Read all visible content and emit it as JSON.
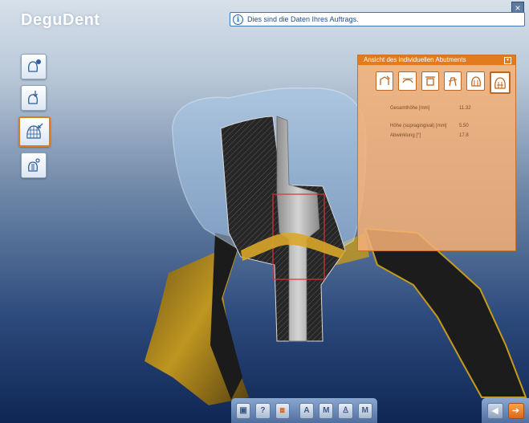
{
  "app": {
    "title": "DeguDent"
  },
  "window": {
    "close_glyph": "×"
  },
  "info": {
    "icon_glyph": "i",
    "message": "Dies sind die Daten Ihres Auftrags."
  },
  "left_toolbar": {
    "items": [
      {
        "icon": "crown-info-icon"
      },
      {
        "icon": "crown-arrow-icon"
      },
      {
        "icon": "mesh-cap-icon",
        "active": true
      },
      {
        "icon": "abutment-edit-icon"
      }
    ]
  },
  "panel": {
    "title": "Ansicht des individuellen Abutments",
    "collapse_glyph": "▾",
    "view_buttons": [
      {
        "icon": "view-front-icon"
      },
      {
        "icon": "view-shoulder-icon"
      },
      {
        "icon": "view-height-icon"
      },
      {
        "icon": "view-angle-icon"
      },
      {
        "icon": "view-crown-icon"
      },
      {
        "icon": "view-full-icon",
        "selected": true
      }
    ],
    "rows": [
      {
        "label": "Gesamthöhe [mm]",
        "value": "11.32"
      },
      {
        "label": "Höhe (supragingival) [mm]",
        "value": "5.50"
      },
      {
        "label": "Abwinklung [°]",
        "value": "17.8"
      }
    ]
  },
  "bottom_toolbar": {
    "buttons": [
      {
        "icon": "save-icon",
        "glyph": "▣"
      },
      {
        "icon": "help-icon",
        "glyph": "?"
      },
      {
        "icon": "screenshot-icon",
        "glyph": "⧈"
      },
      {
        "icon": "abutment-a-icon",
        "glyph": "A"
      },
      {
        "icon": "abutment-m-icon",
        "glyph": "M"
      },
      {
        "icon": "crown-tooth-icon",
        "glyph": "♙"
      },
      {
        "icon": "bridge-icon",
        "glyph": "M"
      }
    ]
  },
  "nav": {
    "back_glyph": "◀",
    "next_glyph": "➔"
  },
  "colors": {
    "accent": "#e27b1e",
    "info_blue": "#1e4f92",
    "gum": "#c79a1c"
  }
}
